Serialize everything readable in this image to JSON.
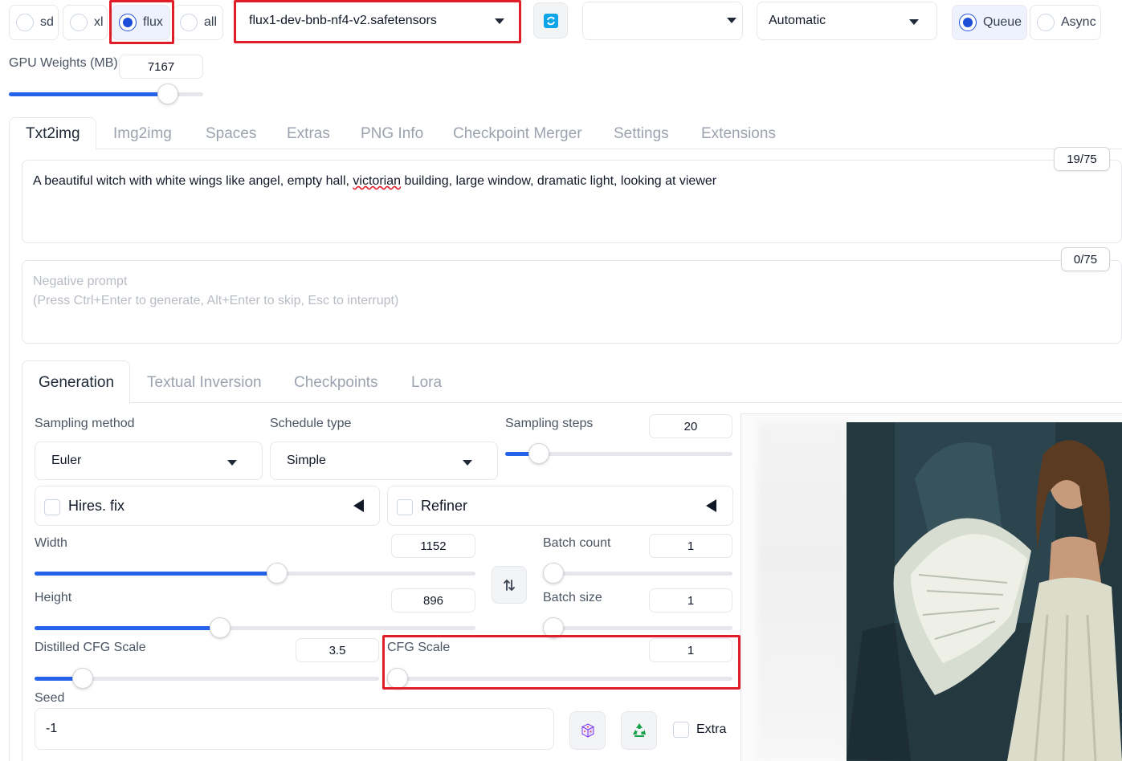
{
  "top_bar": {
    "ui_presets": [
      {
        "label": "sd",
        "selected": false
      },
      {
        "label": "xl",
        "selected": false
      },
      {
        "label": "flux",
        "selected": true
      },
      {
        "label": "all",
        "selected": false
      }
    ],
    "checkpoint": "flux1-dev-bnb-nf4-v2.safetensors",
    "vae_value": "",
    "diffusion_precision": "Automatic",
    "queue_modes": [
      {
        "label": "Queue",
        "selected": true
      },
      {
        "label": "Async",
        "selected": false
      }
    ],
    "gpu_weights_label": "GPU Weights (MB)",
    "gpu_weights_value": "7167",
    "gpu_weights_fraction": 0.82
  },
  "main_tabs": [
    "Txt2img",
    "Img2img",
    "Spaces",
    "Extras",
    "PNG Info",
    "Checkpoint Merger",
    "Settings",
    "Extensions"
  ],
  "prompt": {
    "text_before": "A beautiful witch with white wings like angel, empty hall, ",
    "text_misspelled": "victorian",
    "text_after": " building, large window, dramatic light, looking at viewer",
    "token_count": "19/75"
  },
  "negative_prompt": {
    "placeholder_line1": "Negative prompt",
    "placeholder_line2": "(Press Ctrl+Enter to generate, Alt+Enter to skip, Esc to interrupt)",
    "token_count": "0/75"
  },
  "sub_tabs": [
    "Generation",
    "Textual Inversion",
    "Checkpoints",
    "Lora"
  ],
  "generation": {
    "sampling_method_label": "Sampling method",
    "sampling_method": "Euler",
    "schedule_type_label": "Schedule type",
    "schedule_type": "Simple",
    "sampling_steps_label": "Sampling steps",
    "sampling_steps": "20",
    "sampling_steps_fraction": 0.15,
    "hires_fix_label": "Hires. fix",
    "refiner_label": "Refiner",
    "width_label": "Width",
    "width": "1152",
    "width_fraction": 0.55,
    "height_label": "Height",
    "height": "896",
    "height_fraction": 0.42,
    "batch_count_label": "Batch count",
    "batch_count": "1",
    "batch_size_label": "Batch size",
    "batch_size": "1",
    "distilled_cfg_label": "Distilled CFG Scale",
    "distilled_cfg": "3.5",
    "distilled_cfg_fraction": 0.14,
    "cfg_scale_label": "CFG Scale",
    "cfg_scale": "1",
    "cfg_scale_fraction": 0.0,
    "seed_label": "Seed",
    "seed": "-1",
    "extra_label": "Extra"
  },
  "colors": {
    "accent": "#2563eb",
    "highlight_box": "#e11d2a"
  },
  "icons": {
    "refresh": "refresh-icon",
    "swap": "swap-arrows-icon",
    "dice": "dice-icon",
    "recycle": "recycle-icon"
  }
}
